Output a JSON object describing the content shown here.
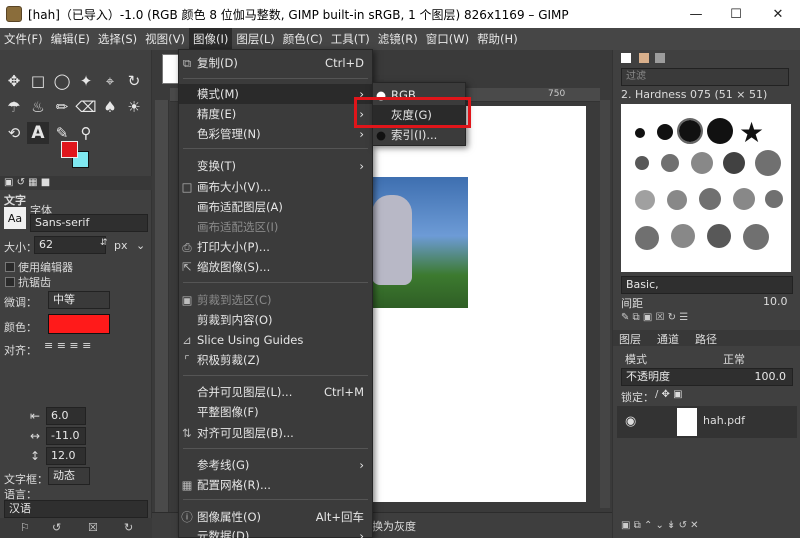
{
  "window": {
    "title": "[hah]（已导入）-1.0 (RGB 颜色 8 位伽马整数, GIMP built-in sRGB, 1 个图层) 826x1169 – GIMP",
    "minimize_icon": "minimize-icon",
    "maximize_icon": "maximize-icon",
    "close_icon": "close-icon"
  },
  "menubar": [
    "文件(F)",
    "编辑(E)",
    "选择(S)",
    "视图(V)",
    "图像(I)",
    "图层(L)",
    "颜色(C)",
    "工具(T)",
    "滤镜(R)",
    "窗口(W)",
    "帮助(H)"
  ],
  "tool_options": {
    "title": "文字",
    "font_label": "字体",
    "font_value": "Sans-serif",
    "size_label": "大小：",
    "size_value": "62",
    "size_unit": "px",
    "use_editor": "使用编辑器",
    "antialias": "抗锯齿",
    "hinting_label": "微调：",
    "hinting_value": "中等",
    "color_label": "颜色：",
    "color_value": "#ff1a1a",
    "justify_label": "对齐：",
    "indent_value": "6.0",
    "letter_spacing_value": "-11.0",
    "line_spacing_value": "12.0",
    "box_label": "文字框：",
    "box_value": "动态",
    "language_label": "语言：",
    "language_value": "汉语"
  },
  "colors": {
    "foreground": "#e0161c",
    "background": "#7fe8f0"
  },
  "ruler": {
    "tick_750": "750"
  },
  "status": {
    "text": "换为灰度"
  },
  "image_menu": {
    "items": [
      {
        "label": "复制(D)",
        "shortcut": "Ctrl+D",
        "icon": "duplicate-icon"
      },
      {
        "label": "模式(M)",
        "submenu": true
      },
      {
        "label": "精度(E)",
        "submenu": true
      },
      {
        "label": "色彩管理(N)",
        "submenu": true
      },
      {
        "label": "变换(T)",
        "submenu": true
      },
      {
        "label": "画布大小(V)...",
        "icon": "canvas-size-icon"
      },
      {
        "label": "画布适配图层(A)"
      },
      {
        "label": "画布适配选区(I)",
        "disabled": true
      },
      {
        "label": "打印大小(P)...",
        "icon": "print-icon"
      },
      {
        "label": "缩放图像(S)...",
        "icon": "scale-icon"
      },
      {
        "label": "剪裁到选区(C)",
        "disabled": true,
        "icon": "crop-icon"
      },
      {
        "label": "剪裁到内容(O)"
      },
      {
        "label": "Slice Using Guides",
        "icon": "slice-icon"
      },
      {
        "label": "积极剪裁(Z)",
        "icon": "zealous-crop-icon"
      },
      {
        "label": "合并可见图层(L)...",
        "shortcut": "Ctrl+M"
      },
      {
        "label": "平整图像(F)"
      },
      {
        "label": "对齐可见图层(B)...",
        "icon": "align-icon"
      },
      {
        "label": "参考线(G)",
        "submenu": true
      },
      {
        "label": "配置网格(R)...",
        "icon": "grid-icon"
      },
      {
        "label": "图像属性(O)",
        "shortcut": "Alt+回车",
        "icon": "info-icon"
      },
      {
        "label": "元数据(D)",
        "submenu": true
      }
    ]
  },
  "mode_submenu": {
    "items": [
      {
        "label": "RGB",
        "selected": true
      },
      {
        "label": "灰度(G)",
        "selected": false
      },
      {
        "label": "索引(I)...",
        "selected": false
      }
    ]
  },
  "right_panel": {
    "filter_placeholder": "过滤",
    "brush_name": "2. Hardness 075 (51 × 51)",
    "preset": "Basic,",
    "spacing_label": "间距",
    "spacing_value": "10.0",
    "tabs": [
      "图层",
      "通道",
      "路径"
    ],
    "mode_label": "模式",
    "mode_value": "正常",
    "opacity_label": "不透明度",
    "opacity_value": "100.0",
    "lock_label": "锁定：",
    "layer_name": "hah.pdf"
  }
}
